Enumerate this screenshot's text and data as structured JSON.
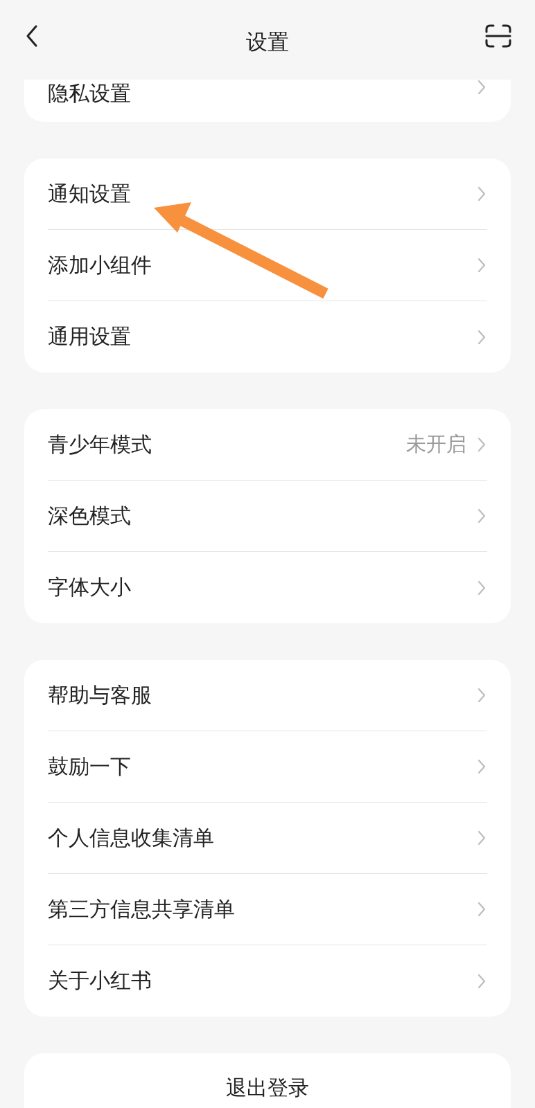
{
  "header": {
    "title": "设置"
  },
  "sections": [
    {
      "items": [
        {
          "label": "隐私设置"
        }
      ]
    },
    {
      "items": [
        {
          "label": "通知设置"
        },
        {
          "label": "添加小组件"
        },
        {
          "label": "通用设置"
        }
      ]
    },
    {
      "items": [
        {
          "label": "青少年模式",
          "value": "未开启"
        },
        {
          "label": "深色模式"
        },
        {
          "label": "字体大小"
        }
      ]
    },
    {
      "items": [
        {
          "label": "帮助与客服"
        },
        {
          "label": "鼓励一下"
        },
        {
          "label": "个人信息收集清单"
        },
        {
          "label": "第三方信息共享清单"
        },
        {
          "label": "关于小红书"
        }
      ]
    }
  ],
  "logout": "退出登录"
}
